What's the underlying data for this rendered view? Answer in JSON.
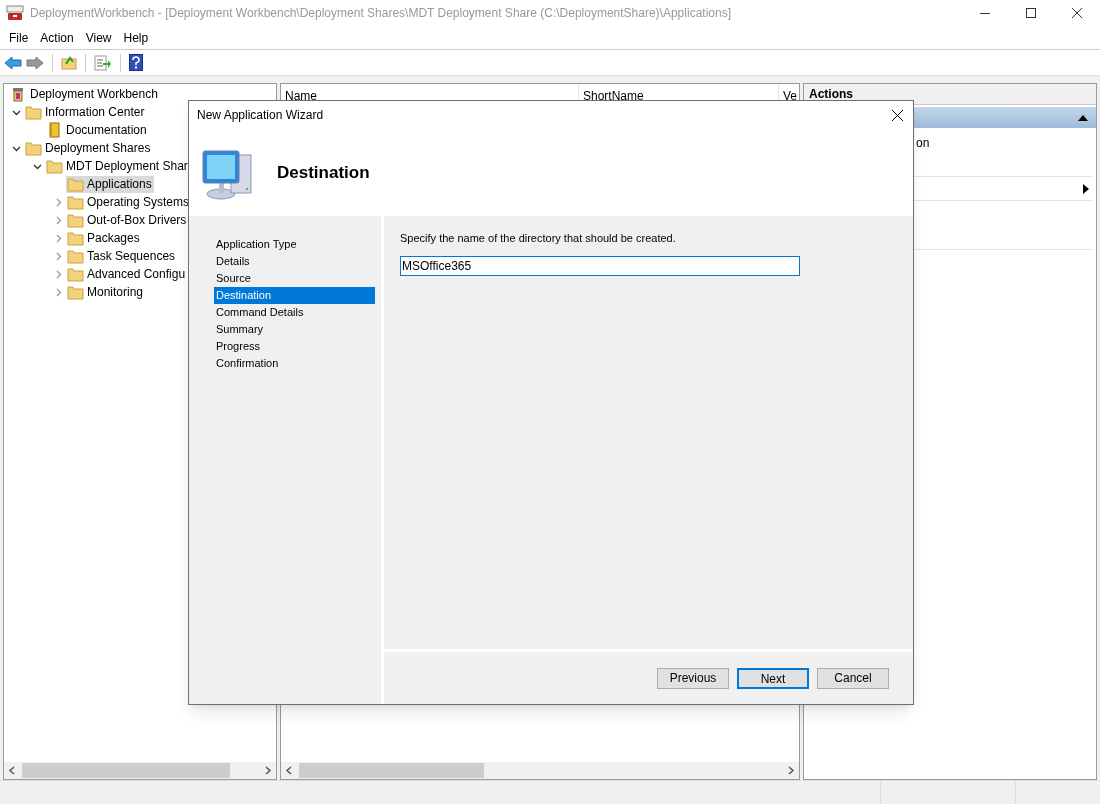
{
  "window": {
    "title": "DeploymentWorkbench - [Deployment Workbench\\Deployment Shares\\MDT Deployment Share (C:\\DeploymentShare)\\Applications]"
  },
  "menu": [
    "File",
    "Action",
    "View",
    "Help"
  ],
  "tree": [
    {
      "label": "Deployment Workbench",
      "kind": "root",
      "selected": false,
      "children": [
        {
          "label": "Information Center",
          "kind": "folder",
          "expanded": true,
          "selected": false,
          "children": [
            {
              "label": "Documentation",
              "kind": "book",
              "selected": false
            }
          ]
        },
        {
          "label": "Deployment Shares",
          "kind": "folder",
          "expanded": true,
          "selected": false,
          "children": [
            {
              "label": "MDT Deployment Shar",
              "kind": "folder",
              "expanded": true,
              "selected": false,
              "children": [
                {
                  "label": "Applications",
                  "kind": "folder",
                  "selected": true
                },
                {
                  "label": "Operating Systems",
                  "kind": "folder",
                  "expanded": false,
                  "selected": false
                },
                {
                  "label": "Out-of-Box Drivers",
                  "kind": "folder",
                  "expanded": false,
                  "selected": false
                },
                {
                  "label": "Packages",
                  "kind": "folder",
                  "expanded": false,
                  "selected": false
                },
                {
                  "label": "Task Sequences",
                  "kind": "folder",
                  "expanded": false,
                  "selected": false
                },
                {
                  "label": "Advanced Configu",
                  "kind": "folder",
                  "expanded": false,
                  "selected": false
                },
                {
                  "label": "Monitoring",
                  "kind": "folder",
                  "expanded": false,
                  "selected": false
                }
              ]
            }
          ]
        }
      ]
    }
  ],
  "list": {
    "columns": [
      "Name",
      "ShortName",
      "Ve"
    ]
  },
  "actions": {
    "title": "Actions",
    "items": [
      "on"
    ]
  },
  "wizard": {
    "title": "New Application Wizard",
    "heading": "Destination",
    "steps": [
      {
        "label": "Application Type",
        "selected": false
      },
      {
        "label": "Details",
        "selected": false
      },
      {
        "label": "Source",
        "selected": false
      },
      {
        "label": "Destination",
        "selected": true
      },
      {
        "label": "Command Details",
        "selected": false
      },
      {
        "label": "Summary",
        "selected": false
      },
      {
        "label": "Progress",
        "selected": false
      },
      {
        "label": "Confirmation",
        "selected": false
      }
    ],
    "prompt": "Specify the name of the directory that should be created.",
    "field_value": "MSOffice365",
    "buttons": [
      {
        "label": "Previous",
        "default": false
      },
      {
        "label": "Next",
        "default": true
      },
      {
        "label": "Cancel",
        "default": false
      }
    ]
  }
}
